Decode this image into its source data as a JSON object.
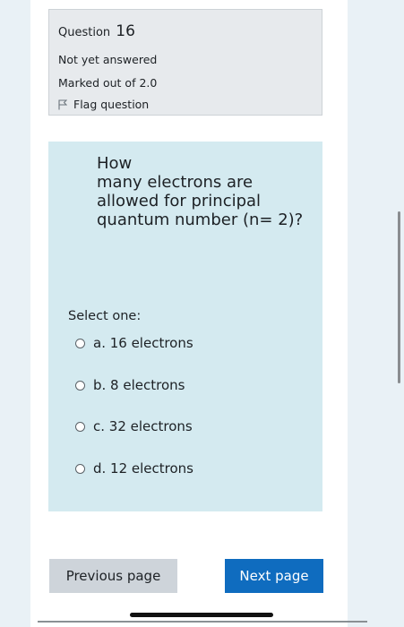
{
  "question": {
    "label": "Question",
    "number": "16",
    "state": "Not yet answered",
    "grade": "Marked out of 2.0",
    "flag_label": "Flag question",
    "flag_icon": "flag-icon",
    "text_line1": "How",
    "text_rest": "many electrons are allowed for principal quantum number (n= 2)?"
  },
  "answers": {
    "prompt": "Select one:",
    "options": [
      {
        "label": "a. 16 electrons"
      },
      {
        "label": "b. 8 electrons"
      },
      {
        "label": "c. 32 electrons"
      },
      {
        "label": "d. 12 electrons"
      }
    ]
  },
  "navigation": {
    "previous_label": "Previous page",
    "next_label": "Next page"
  },
  "colors": {
    "page_background": "#e9f1f6",
    "info_box": "#e7eaed",
    "content_box": "#d4eaf0",
    "primary_button": "#0f6cbf",
    "secondary_button": "#ced4da"
  }
}
